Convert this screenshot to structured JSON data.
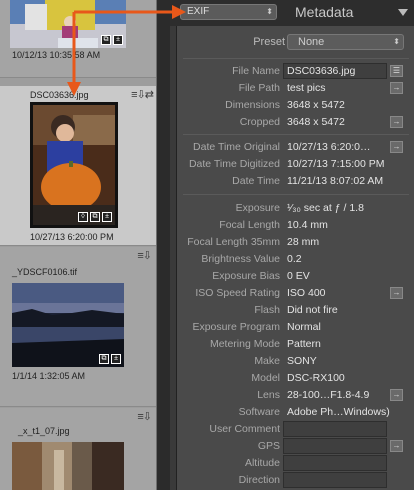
{
  "filmstrip": {
    "cells": [
      {
        "timestamp": "10/12/13 10:35:58 AM"
      },
      {
        "filename": "DSC03636.jpg",
        "timestamp": "10/27/13 6:20:00 PM"
      },
      {
        "filename": "_YDSCF0106.tif",
        "timestamp": "1/1/14 1:32:05 AM"
      },
      {
        "filename": "_x_t1_07.jpg"
      }
    ]
  },
  "panel": {
    "source_select": "EXIF",
    "title": "Metadata",
    "preset_label": "Preset",
    "preset_value": "None"
  },
  "fields": [
    {
      "label": "File Name",
      "value": "DSC03636.jpg"
    },
    {
      "label": "File Path",
      "value": "test pics"
    },
    {
      "label": "Dimensions",
      "value": "3648 x 5472"
    },
    {
      "label": "Cropped",
      "value": "3648 x 5472"
    },
    {
      "label": "Date Time Original",
      "value": "10/27/13 6:20:0…"
    },
    {
      "label": "Date Time Digitized",
      "value": "10/27/13 7:15:00 PM"
    },
    {
      "label": "Date Time",
      "value": "11/21/13 8:07:02 AM"
    },
    {
      "label": "Exposure",
      "value": "¹⁄₃₀ sec at ƒ / 1.8"
    },
    {
      "label": "Focal Length",
      "value": "10.4 mm"
    },
    {
      "label": "Focal Length 35mm",
      "value": "28 mm"
    },
    {
      "label": "Brightness Value",
      "value": "0.2"
    },
    {
      "label": "Exposure Bias",
      "value": "0 EV"
    },
    {
      "label": "ISO Speed Rating",
      "value": "ISO 400"
    },
    {
      "label": "Flash",
      "value": "Did not fire"
    },
    {
      "label": "Exposure Program",
      "value": "Normal"
    },
    {
      "label": "Metering Mode",
      "value": "Pattern"
    },
    {
      "label": "Make",
      "value": "SONY"
    },
    {
      "label": "Model",
      "value": "DSC-RX100"
    },
    {
      "label": "Lens",
      "value": "28-100…F1.8-4.9"
    },
    {
      "label": "Software",
      "value": "Adobe Ph…Windows)"
    },
    {
      "label": "User Comment",
      "value": ""
    },
    {
      "label": "GPS",
      "value": ""
    },
    {
      "label": "Altitude",
      "value": ""
    },
    {
      "label": "Direction",
      "value": ""
    }
  ],
  "colors": {
    "annotation_arrow": "#e8581a",
    "panel_bg": "#4a4a4a",
    "filmstrip_bg": "#9d9d9d"
  }
}
